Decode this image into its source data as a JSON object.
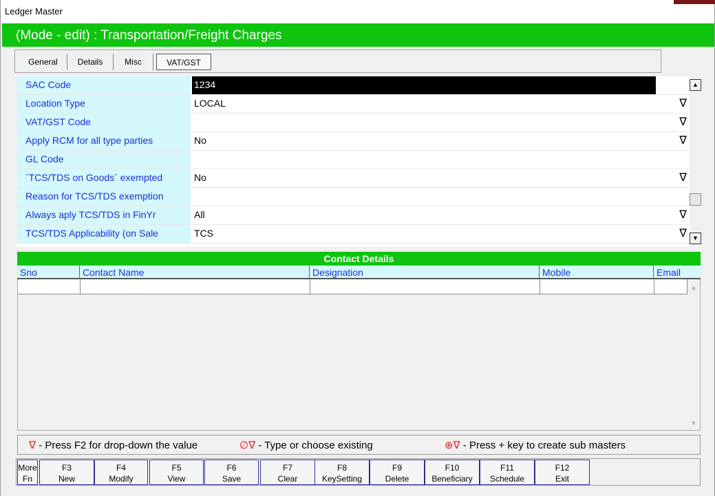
{
  "window": {
    "title": "Ledger Master"
  },
  "mode_bar": {
    "text": "(Mode - edit)  :  Transportation/Freight Charges"
  },
  "tabs": [
    {
      "label": "General"
    },
    {
      "label": "Details"
    },
    {
      "label": "Misc"
    },
    {
      "label": "VAT/GST",
      "active": true
    }
  ],
  "fields": [
    {
      "label": "SAC Code",
      "value": "1234",
      "dropdown": false
    },
    {
      "label": "Location Type",
      "value": "LOCAL",
      "dropdown": true
    },
    {
      "label": "VAT/GST Code",
      "value": "",
      "dropdown": true
    },
    {
      "label": "Apply RCM for all type parties",
      "value": "No",
      "dropdown": true
    },
    {
      "label": "GL Code",
      "value": "",
      "dropdown": false
    },
    {
      "label": "`TCS/TDS on Goods` exempted",
      "value": "No",
      "dropdown": true
    },
    {
      "label": "Reason for TCS/TDS exemption",
      "value": "",
      "dropdown": false
    },
    {
      "label": "Always aply TCS/TDS in FinYr",
      "value": "All",
      "dropdown": true
    },
    {
      "label": "TCS/TDS Applicability (on Sale",
      "value": "TCS",
      "dropdown": true
    }
  ],
  "dropdown_glyph": "∇",
  "contact_details": {
    "title": "Contact Details",
    "columns": [
      "Sno",
      "Contact Name",
      "Designation",
      "Mobile",
      "Email"
    ]
  },
  "legend": {
    "items": [
      {
        "symbol": "∇",
        "text": " - Press F2 for drop-down the value"
      },
      {
        "symbol": "∅∇",
        "text": " - Type or choose existing"
      },
      {
        "symbol": "⊕∇",
        "text": " - Press + key to create sub masters"
      }
    ]
  },
  "function_keys": [
    {
      "key": "More",
      "label": "Fn"
    },
    {
      "key": "F3",
      "label": "New"
    },
    {
      "key": "F4",
      "label": "Modify"
    },
    {
      "key": "F5",
      "label": "View"
    },
    {
      "key": "F6",
      "label": "Save"
    },
    {
      "key": "F7",
      "label": "Clear"
    },
    {
      "key": "F8",
      "label": "KeySetting"
    },
    {
      "key": "F9",
      "label": "Delete"
    },
    {
      "key": "F10",
      "label": "Beneficiary"
    },
    {
      "key": "F11",
      "label": "Schedule"
    },
    {
      "key": "F12",
      "label": "Exit"
    }
  ],
  "colors": {
    "green": "#0fc40f",
    "label_bg": "#d4f8fc",
    "label_text": "#1a2fd9",
    "legend_red": "#e21b1b"
  }
}
